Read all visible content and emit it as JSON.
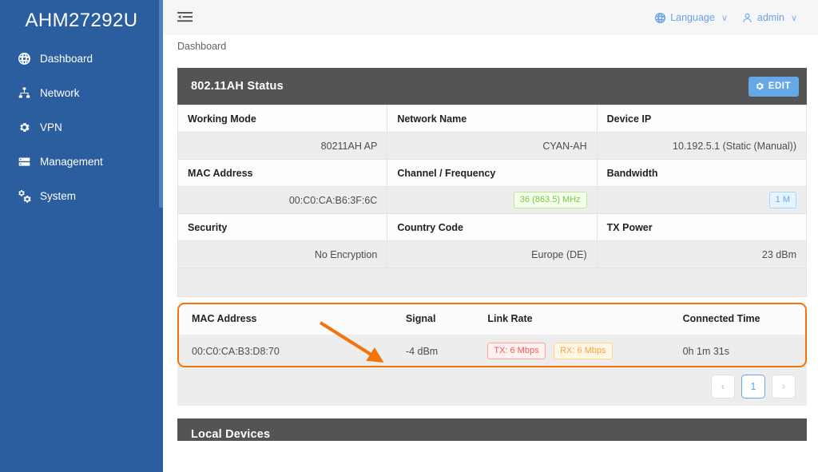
{
  "sidebar": {
    "brand": "AHM27292U",
    "items": [
      {
        "label": "Dashboard",
        "icon": "globe-icon"
      },
      {
        "label": "Network",
        "icon": "network-tree-icon"
      },
      {
        "label": "VPN",
        "icon": "gear-icon"
      },
      {
        "label": "Management",
        "icon": "server-stack-icon"
      },
      {
        "label": "System",
        "icon": "gears-icon"
      }
    ],
    "bg_color": "#2a5e9e"
  },
  "topbar": {
    "fold_icon": "menu-fold-icon",
    "language_label": "Language",
    "language_icon": "globe-icon",
    "user_label": "admin",
    "user_icon": "user-icon",
    "caret": "∨",
    "link_color": "#6ba3e0"
  },
  "breadcrumb": {
    "text": "Dashboard"
  },
  "status_card": {
    "title": "802.11AH Status",
    "edit_label": "EDIT",
    "edit_icon": "gear-icon",
    "header_bg": "#545454",
    "edit_bg": "#64a8e8",
    "rows": [
      {
        "headers": [
          "Working Mode",
          "Network Name",
          "Device IP"
        ],
        "values": [
          "80211AH AP",
          "CYAN-AH",
          "10.192.5.1 (Static (Manual))"
        ]
      },
      {
        "headers": [
          "MAC Address",
          "Channel / Frequency",
          "Bandwidth"
        ],
        "values": [
          "00:C0:CA:B6:3F:6C",
          "36 (863.5) MHz",
          "1 M"
        ],
        "value_styles": [
          "plain",
          "badge-green",
          "badge-blue"
        ]
      },
      {
        "headers": [
          "Security",
          "Country Code",
          "TX Power"
        ],
        "values": [
          "No Encryption",
          "Europe (DE)",
          "23 dBm"
        ]
      }
    ]
  },
  "clients_table": {
    "columns": [
      "MAC Address",
      "Signal",
      "Link Rate",
      "Connected Time"
    ],
    "rows": [
      {
        "mac": "00:C0:CA:B3:D8:70",
        "signal": "-4 dBm",
        "tx": "TX: 6 Mbps",
        "rx": "RX: 6 Mbps",
        "connected_time": "0h 1m 31s"
      }
    ],
    "highlight_color": "#f3740b"
  },
  "pagination": {
    "prev": "‹",
    "pages": [
      "1"
    ],
    "next": "›",
    "current": "1"
  },
  "bottom_card": {
    "title": "Local Devices"
  },
  "annotation": {
    "arrow_color": "#f3740b"
  }
}
